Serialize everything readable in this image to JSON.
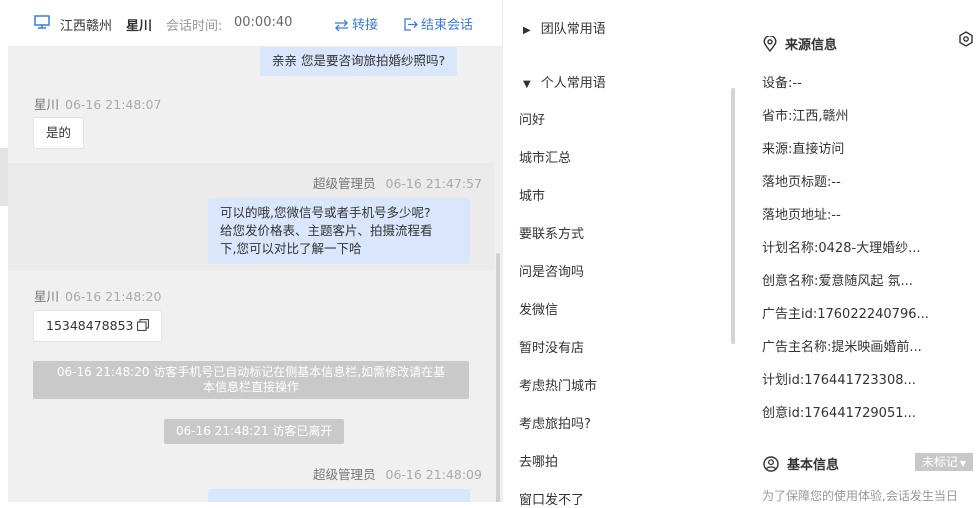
{
  "header": {
    "location": "江西赣州",
    "visitor_name": "星川",
    "session_time_label": "会话时间:",
    "session_time": "00:00:40",
    "transfer_label": "转接",
    "end_session_label": "结束会话"
  },
  "chat": {
    "messages": [
      {
        "text": "亲亲 您是要咨询旅拍婚纱照吗?"
      },
      {
        "sender": "星川",
        "time": "06-16 21:48:07",
        "text": "是的"
      },
      {
        "sender": "超级管理员",
        "time": "06-16 21:47:57",
        "line1": "可以的哦,您微信号或者手机号多少呢?",
        "line2": "给您发价格表、主题客片、拍摄流程看",
        "line3": "下,您可以对比了解一下哈"
      },
      {
        "sender": "星川",
        "time": "06-16 21:48:20",
        "text": "15348478853"
      },
      {
        "line1": "06-16 21:48:20 访客手机号已自动标记在侧基本信息栏,如需修改请在基",
        "line2": "本信息栏直接操作"
      },
      {
        "text": "06-16 21:48:21 访客已离开"
      },
      {
        "sender": "超级管理员",
        "time": "06-16 21:48:09"
      }
    ]
  },
  "phrases": {
    "team_group": "团队常用语",
    "personal_group": "个人常用语",
    "items": [
      "问好",
      "城市汇总",
      "城市",
      "要联系方式",
      "问是咨询吗",
      "发微信",
      "暂时没有店",
      "考虑热门城市",
      "考虑旅拍吗?",
      "去哪拍",
      "窗口发不了"
    ]
  },
  "info": {
    "source_title": "来源信息",
    "rows": [
      "设备:--",
      "省市:江西,赣州",
      "来源:直接访问",
      "落地页标题:--",
      "落地页地址:--",
      "计划名称:0428-大理婚纱...",
      "创意名称:爱意随风起 氛...",
      "广告主id:176022240796...",
      "广告主名称:提米映画婚前...",
      "计划id:176441723308...",
      "创意id:176441729051..."
    ],
    "basic_title": "基本信息",
    "tag_label": "未标记",
    "notice": "为了保障您的使用体验,会话发生当日"
  }
}
